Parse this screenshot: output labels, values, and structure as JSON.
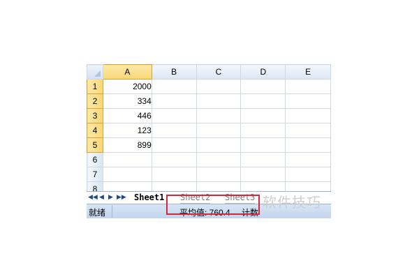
{
  "spreadsheet": {
    "columns": [
      "A",
      "B",
      "C",
      "D",
      "E"
    ],
    "rows": [
      {
        "num": "1",
        "a": "2000"
      },
      {
        "num": "2",
        "a": "334"
      },
      {
        "num": "3",
        "a": "446"
      },
      {
        "num": "4",
        "a": "123"
      },
      {
        "num": "5",
        "a": "899"
      },
      {
        "num": "6",
        "a": ""
      },
      {
        "num": "7",
        "a": ""
      },
      {
        "num": "8",
        "a": ""
      }
    ]
  },
  "sheet_tabs": {
    "nav_first": "◀◀",
    "nav_prev": "◀",
    "nav_next": "▶",
    "nav_last": "▶▶",
    "tabs": [
      "Sheet1",
      "Sheet2",
      "Sheet3"
    ],
    "active": "Sheet1"
  },
  "status_bar": {
    "mode": "就绪",
    "average": "平均值: 760.4",
    "count": "计数"
  },
  "watermark": "软件技巧",
  "colors": {
    "highlight_box": "#d6283c",
    "status_bar": "#c9daf0"
  }
}
